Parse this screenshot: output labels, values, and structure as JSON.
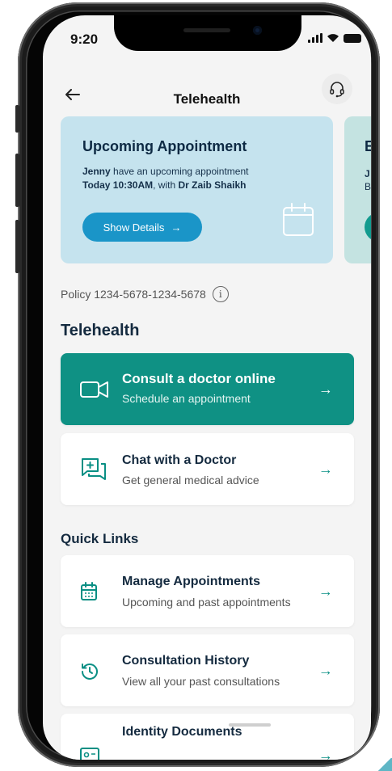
{
  "status_bar": {
    "time": "9:20"
  },
  "header": {
    "title": "Telehealth"
  },
  "appointment": {
    "title": "Upcoming Appointment",
    "patient": "Jenny",
    "line1_rest": " have an upcoming appointment",
    "when": "Today 10:30AM",
    "with_text": ", with ",
    "doctor": "Dr Zaib Shaikh",
    "button": "Show Details",
    "button_arrow": "→"
  },
  "next_card": {
    "title_partial": "E",
    "line1_partial": "J",
    "line2_partial": "B"
  },
  "policy": {
    "text": "Policy 1234-5678-1234-5678",
    "info_glyph": "i"
  },
  "telehealth": {
    "heading": "Telehealth",
    "items": [
      {
        "title": "Consult a doctor online",
        "subtitle": "Schedule an appointment",
        "icon": "video-camera-icon",
        "arrow": "→"
      },
      {
        "title": "Chat with a Doctor",
        "subtitle": "Get general medical advice",
        "icon": "chat-plus-icon",
        "arrow": "→"
      }
    ]
  },
  "quick_links": {
    "heading": "Quick Links",
    "items": [
      {
        "title": "Manage Appointments",
        "subtitle": "Upcoming and past appointments",
        "icon": "calendar-icon",
        "arrow": "→"
      },
      {
        "title": "Consultation History",
        "subtitle": "View all your past consultations",
        "icon": "history-icon",
        "arrow": "→"
      },
      {
        "title": "Identity Documents",
        "subtitle": "",
        "icon": "id-card-icon",
        "arrow": "→"
      }
    ]
  },
  "colors": {
    "primary_teal": "#0f9184",
    "card_blue": "#c5e3ee",
    "button_blue": "#1a95c8",
    "background": "#f4f4f4"
  }
}
